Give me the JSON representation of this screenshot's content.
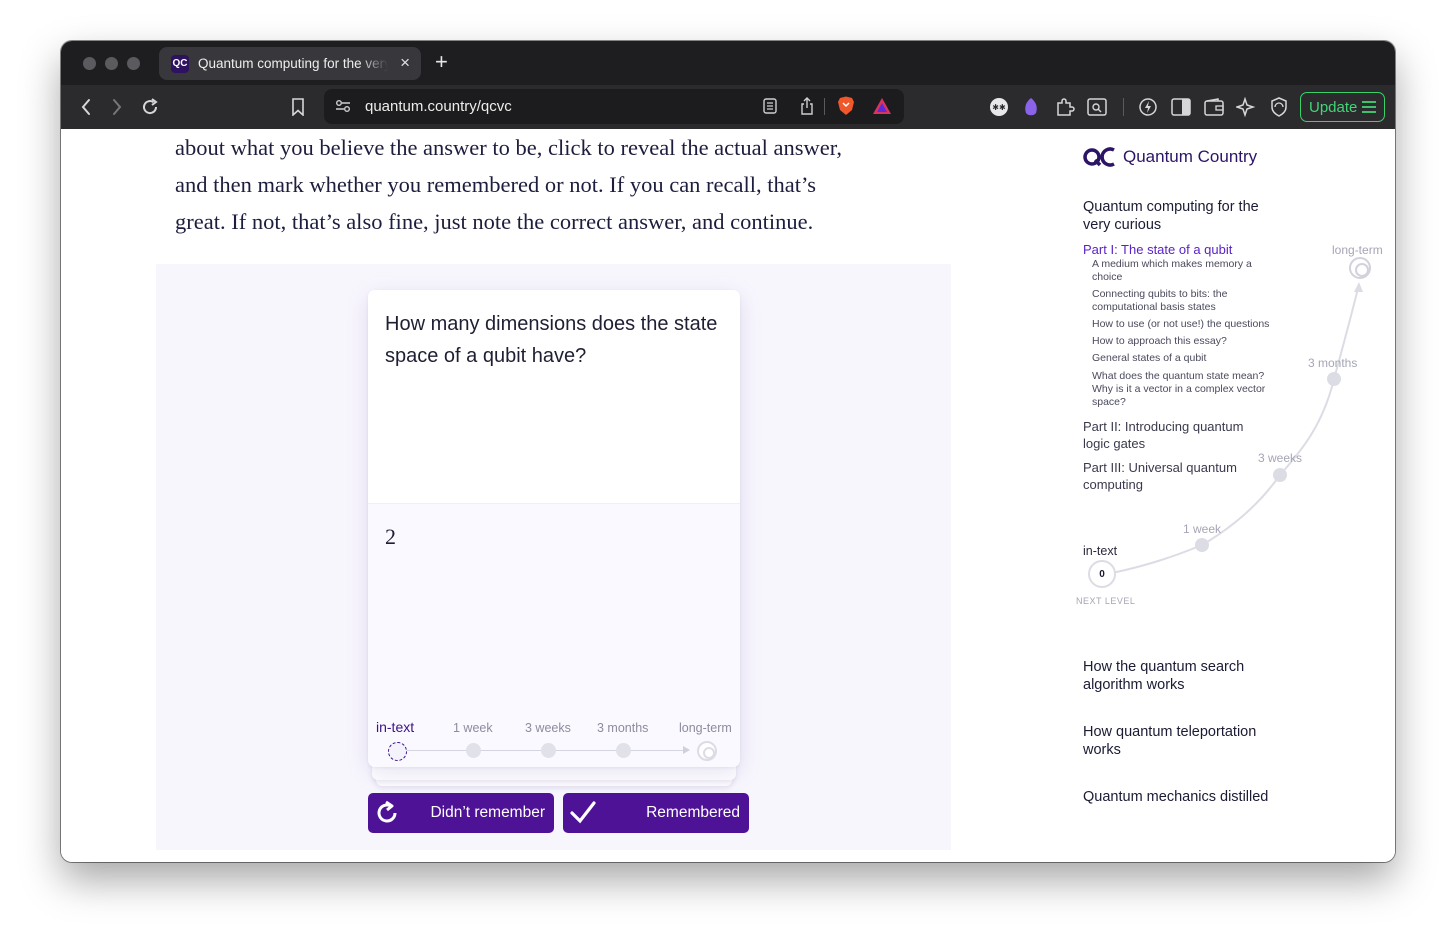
{
  "browser": {
    "tab_title": "Quantum computing for the very curious",
    "tab_favicon_label": "QC",
    "close_glyph": "×",
    "newtab_glyph": "+",
    "url": "quantum.country/qcvc",
    "update_label": "Update",
    "accent_update": "#38d16a"
  },
  "article": {
    "lines": [
      "about what you believe the answer to be, click to reveal the actual answer,",
      "and then mark whether you remembered or not. If you can recall, that’s",
      "great. If not, that’s also fine, just note the correct answer, and continue."
    ]
  },
  "card": {
    "question": "How many dimensions does the state space of a qubit have?",
    "answer": "2",
    "timeline": [
      "in-text",
      "1 week",
      "3 weeks",
      "3 months",
      "long-term"
    ]
  },
  "actions": {
    "didnt_remember": "Didn’t remember",
    "remembered": "Remembered",
    "button_color": "#4d1295"
  },
  "sidebar": {
    "brand": "Quantum Country",
    "essay_title": "Quantum computing for the very curious",
    "parts": [
      {
        "label": "Part I: The state of a qubit",
        "active": true,
        "sections": [
          "A medium which makes memory a choice",
          "Connecting qubits to bits: the computational basis states",
          "How to use (or not use!) the questions",
          "How to approach this essay?",
          "General states of a qubit",
          "What does the quantum state mean? Why is it a vector in a complex vector space?"
        ]
      },
      {
        "label": "Part II: Introducing quantum logic gates",
        "active": false,
        "sections": []
      },
      {
        "label": "Part III: Universal quantum computing",
        "active": false,
        "sections": []
      }
    ],
    "progress": {
      "levels": [
        "in-text",
        "1 week",
        "3 weeks",
        "3 months",
        "long-term"
      ],
      "count": "0",
      "caption": "NEXT LEVEL"
    },
    "other_essays": [
      "How the quantum search algorithm works",
      "How quantum teleportation works",
      "Quantum mechanics distilled"
    ]
  }
}
